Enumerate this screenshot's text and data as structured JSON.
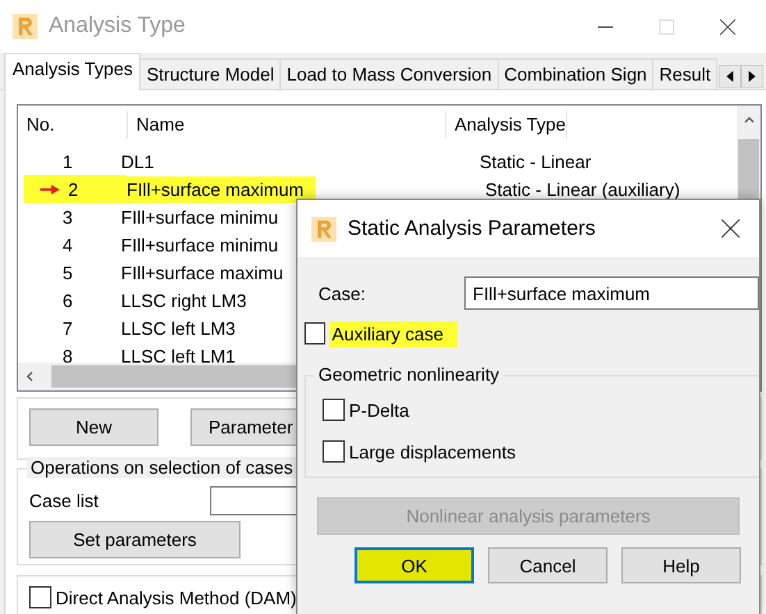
{
  "window": {
    "title": "Analysis Type"
  },
  "tabs": [
    {
      "label": "Analysis Types",
      "selected": true
    },
    {
      "label": "Structure Model",
      "selected": false
    },
    {
      "label": "Load to Mass Conversion",
      "selected": false
    },
    {
      "label": "Combination Sign",
      "selected": false
    },
    {
      "label": "Result",
      "selected": false
    }
  ],
  "table": {
    "columns": [
      "No.",
      "Name",
      "Analysis Type"
    ],
    "rows": [
      {
        "no": "1",
        "name": "DL1",
        "type": "Static - Linear",
        "marked": false,
        "highlighted": false
      },
      {
        "no": "2",
        "name": "FIll+surface maximum",
        "type": "Static - Linear (auxiliary)",
        "marked": true,
        "highlighted": true
      },
      {
        "no": "3",
        "name": "FIll+surface minimu",
        "marked": false,
        "highlighted": false
      },
      {
        "no": "4",
        "name": "FIll+surface minimu",
        "marked": false,
        "highlighted": false
      },
      {
        "no": "5",
        "name": "FIll+surface maximu",
        "marked": false,
        "highlighted": false
      },
      {
        "no": "6",
        "name": "LLSC right LM3",
        "marked": false,
        "highlighted": false
      },
      {
        "no": "7",
        "name": "LLSC left LM3",
        "marked": false,
        "highlighted": false
      },
      {
        "no": "8",
        "name": "LLSC left LM1",
        "marked": false,
        "highlighted": false
      }
    ]
  },
  "buttons": [
    "New",
    "Parameter"
  ],
  "operations": {
    "title": "Operations on selection of cases",
    "case_list_label": "Case list",
    "button": "Set parameters"
  },
  "dam": {
    "label": "Direct Analysis Method (DAM)",
    "checked": false
  },
  "dialog": {
    "title": "Static Analysis Parameters",
    "case_label": "Case:",
    "case_value": "FIll+surface maximum",
    "auxiliary": {
      "label": "Auxiliary case",
      "checked": false,
      "highlighted": true
    },
    "group_title": "Geometric nonlinearity",
    "options": [
      {
        "label": "P-Delta",
        "checked": false
      },
      {
        "label": "Large displacements",
        "checked": false
      }
    ],
    "nonlinear_button": {
      "label": "Nonlinear analysis parameters",
      "disabled": true
    },
    "buttons": [
      {
        "label": "OK",
        "highlighted": true,
        "focused": true
      },
      {
        "label": "Cancel",
        "highlighted": false,
        "focused": false
      },
      {
        "label": "Help",
        "highlighted": false,
        "focused": false
      }
    ]
  }
}
